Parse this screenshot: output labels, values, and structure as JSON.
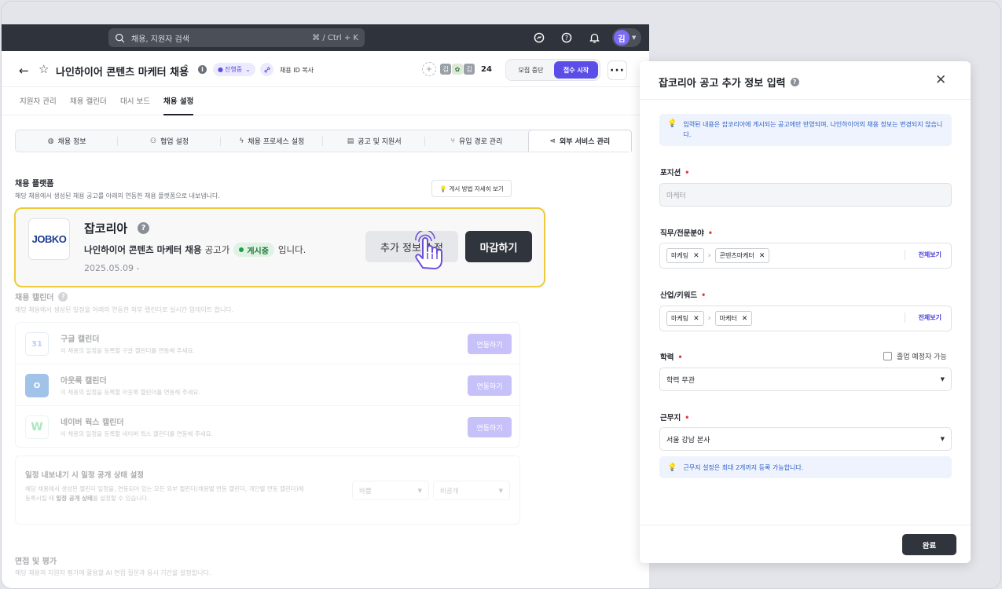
{
  "topbar": {
    "search_placeholder": "채용, 지원자 검색",
    "search_shortcut": "⌘ / Ctrl + K",
    "avatar_initial": "김"
  },
  "header": {
    "title": "나인하이어 콘텐츠 마케터 채용",
    "status": "진행중",
    "copy_id_label": "채용 ID 복사",
    "member_avatars": [
      "김",
      "",
      "김"
    ],
    "member_count": "24",
    "pause_label": "모집 중단",
    "start_label": "접수 시작"
  },
  "tabs": [
    "지원자 관리",
    "채용 캘린더",
    "대시 보드",
    "채용 설정"
  ],
  "subtabs": [
    "채용 정보",
    "협업 설정",
    "채용 프로세스 설정",
    "공고 및 지원서",
    "유입 경로 관리",
    "외부 서비스 관리"
  ],
  "platform": {
    "title": "채용 플랫폼",
    "desc": "해당 채용에서 생성된 채용 공고를 아래의 연동한 채용 플랫폼으로 내보냅니다.",
    "how_label": "게시 방법 자세히 보기",
    "card": {
      "logo_text": "JOBKO",
      "name": "잡코리아",
      "posting_name": "나인하이어 콘텐츠 마케터 채용",
      "text_mid": "공고가",
      "status": "게시중",
      "text_end": "입니다.",
      "date": "2025.05.09 -",
      "edit_label": "추가 정보 수정",
      "close_label": "마감하기"
    }
  },
  "calendar": {
    "title": "채용 캘린더",
    "desc": "해당 채용에서 생성된 일정을 아래의 연동한 외부 캘린더로 실시간 업데이트 합니다.",
    "items": [
      {
        "name": "구글 캘린더",
        "desc": "이 채용의 일정을 등록할 구글 캘린더를 연동해 주세요.",
        "btn": "연동하기",
        "icon": "31"
      },
      {
        "name": "아웃룩 캘린더",
        "desc": "이 채용의 일정을 등록할 아웃룩 캘린더를 연동해 주세요.",
        "btn": "연동하기",
        "icon": "O"
      },
      {
        "name": "네이버 웍스 캘린더",
        "desc": "이 채용의 일정을 등록할 네이버 웍스 캘린더를 연동해 주세요.",
        "btn": "연동하기",
        "icon": "W"
      }
    ],
    "export": {
      "title": "일정 내보내기 시 일정 공개 상태 설정",
      "desc1": "해당 채용에서 생성된 캘린더 일정을, 연동되어 있는 모든 외부 캘린더(채용별 연동 캘린더, 개인별 연동 캘린더)에",
      "desc2a": "등록시킬 때",
      "desc2b": "일정 공개 상태",
      "desc2c": "를 설정할 수 있습니다.",
      "select1": "바쁨",
      "select2": "비공개"
    }
  },
  "interview": {
    "title": "면접 및 평가",
    "desc": "해당 채용의 지원자 평가에 활용할 AI 면접 질문과 응시 기간을 설정합니다."
  },
  "panel": {
    "title": "잡코리아 공고 추가 정보 입력",
    "notice": "입력된 내용은 잡코리아에 게시되는 공고에만 반영되며, 나인하이어의 채용 정보는 변경되지 않습니다.",
    "position_label": "포지션",
    "position_value": "마케터",
    "job_label": "직무/전문분야",
    "job_chips": [
      "마케팅",
      "콘텐츠마케터"
    ],
    "industry_label": "산업/키워드",
    "industry_chips": [
      "마케팅",
      "마케터"
    ],
    "view_all": "전체보기",
    "edu_label": "학력",
    "grad_label": "졸업 예정자 가능",
    "edu_value": "학력 무관",
    "loc_label": "근무지",
    "loc_value": "서울 강남 본사",
    "loc_hint": "근무지 설정은 최대 2개까지 등록 가능합니다.",
    "done_label": "완료"
  },
  "colors": {
    "accent": "#5b4ee8",
    "highlight_border": "#f0c93a",
    "live_green": "#1f7a3b",
    "dark_button": "#30343c"
  }
}
